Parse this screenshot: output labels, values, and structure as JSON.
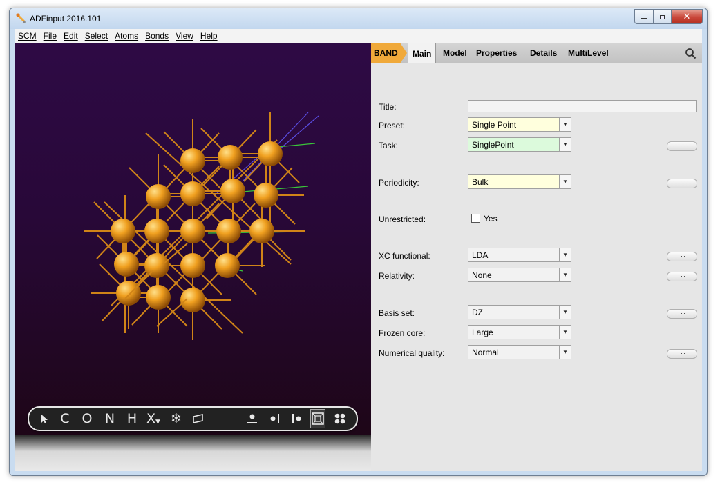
{
  "window": {
    "title": "ADFinput 2016.101"
  },
  "menu": [
    "SCM",
    "File",
    "Edit",
    "Select",
    "Atoms",
    "Bonds",
    "View",
    "Help"
  ],
  "toolbar": {
    "tools": [
      "C",
      "O",
      "N",
      "H",
      "X"
    ],
    "icons": [
      "pointer-icon",
      "element-c",
      "element-o",
      "element-n",
      "element-h",
      "element-x-dropdown",
      "freeze-icon",
      "plane-icon",
      "atom-symbol-icon",
      "atom-left-icon",
      "atom-right-icon",
      "cell-view-icon",
      "cluster-icon"
    ]
  },
  "tabs": {
    "band": "BAND",
    "items": [
      "Main",
      "Model",
      "Properties",
      "Details",
      "MultiLevel"
    ],
    "active": "Main"
  },
  "form": {
    "title": {
      "label": "Title:",
      "value": ""
    },
    "preset": {
      "label": "Preset:",
      "value": "Single Point"
    },
    "task": {
      "label": "Task:",
      "value": "SinglePoint"
    },
    "periodicity": {
      "label": "Periodicity:",
      "value": "Bulk"
    },
    "unrestricted": {
      "label": "Unrestricted:",
      "checkbox_label": "Yes",
      "checked": false
    },
    "xc": {
      "label": "XC functional:",
      "value": "LDA"
    },
    "relativity": {
      "label": "Relativity:",
      "value": "None"
    },
    "basis": {
      "label": "Basis set:",
      "value": "DZ"
    },
    "frozen": {
      "label": "Frozen core:",
      "value": "Large"
    },
    "numerical": {
      "label": "Numerical quality:",
      "value": "Normal"
    },
    "more_button": "···"
  },
  "colors": {
    "band_tab": "#f0a93a",
    "viewport_top": "#2e0a45",
    "viewport_bottom": "#1c0612",
    "atom": "#f0a020",
    "bond": "#d08418",
    "cell_axis_a": "#5a4ce0",
    "cell_axis_b": "#3ac43a"
  }
}
